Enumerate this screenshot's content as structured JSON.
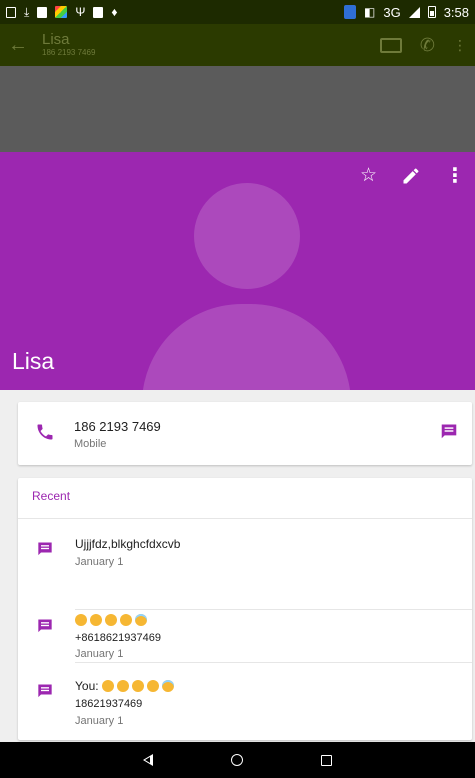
{
  "status_bar": {
    "network": "3G",
    "time": "3:58"
  },
  "app_bar": {
    "title": "Lisa",
    "subtitle": "186 2193 7469"
  },
  "header": {
    "name": "Lisa",
    "color": "#9c27b0"
  },
  "phone": {
    "number": "186 2193 7469",
    "type": "Mobile"
  },
  "recent": {
    "title": "Recent",
    "items": [
      {
        "text": "Ujjjfdz,blkghcfdxcvb",
        "sender": "",
        "emoji_count": 0,
        "number": "",
        "date": "January 1"
      },
      {
        "text": "",
        "sender": "",
        "emoji_count": 5,
        "number": "+8618621937469",
        "date": "January 1"
      },
      {
        "text": "You:",
        "sender": "You:",
        "emoji_count": 5,
        "number": "18621937469",
        "date": "January 1"
      }
    ]
  },
  "icons": {
    "phone": "phone-icon",
    "message": "message-icon",
    "star": "star-icon",
    "edit": "edit-icon",
    "more": "more-vert-icon"
  },
  "colors": {
    "accent": "#9c27b0",
    "status_bar": "#1d2a00"
  }
}
